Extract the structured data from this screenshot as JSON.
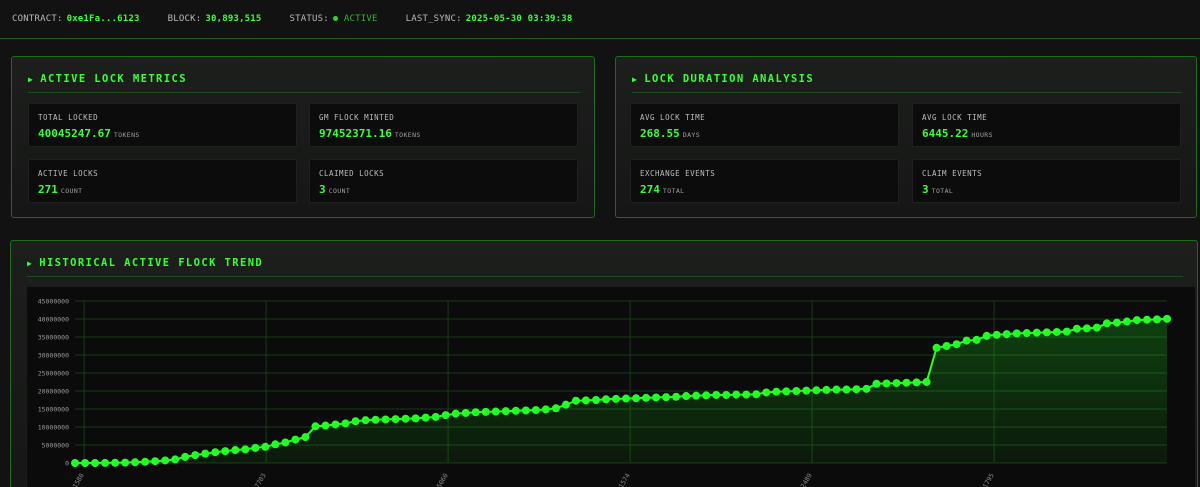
{
  "topbar": {
    "contract_label": "CONTRACT:",
    "contract_value": "0xe1Fa...6123",
    "block_label": "BLOCK:",
    "block_value": "30,893,515",
    "status_label": "STATUS:",
    "status_value": "ACTIVE",
    "sync_label": "LAST_SYNC:",
    "sync_value": "2025-05-30 03:39:38"
  },
  "lock_metrics": {
    "title": "ACTIVE LOCK METRICS",
    "cards": [
      {
        "label": "TOTAL LOCKED",
        "value": "40045247.67",
        "unit": "TOKENS"
      },
      {
        "label": "GM FLOCK MINTED",
        "value": "97452371.16",
        "unit": "TOKENS"
      },
      {
        "label": "ACTIVE LOCKS",
        "value": "271",
        "unit": "COUNT"
      },
      {
        "label": "CLAIMED LOCKS",
        "value": "3",
        "unit": "COUNT"
      }
    ]
  },
  "duration": {
    "title": "LOCK DURATION ANALYSIS",
    "cards": [
      {
        "label": "AVG LOCK TIME",
        "value": "268.55",
        "unit": "DAYS"
      },
      {
        "label": "AVG LOCK TIME",
        "value": "6445.22",
        "unit": "HOURS"
      },
      {
        "label": "EXCHANGE EVENTS",
        "value": "274",
        "unit": "TOTAL"
      },
      {
        "label": "CLAIM EVENTS",
        "value": "3",
        "unit": "TOTAL"
      }
    ]
  },
  "trend": {
    "title": "HISTORICAL ACTIVE FLOCK TREND"
  },
  "colors": {
    "accent": "#39ff39",
    "line": "#22ff22",
    "border": "#1e6b1e",
    "background": "#121212"
  },
  "chart_data": {
    "type": "line",
    "title": "HISTORICAL ACTIVE FLOCK TREND",
    "ylim": [
      0,
      45000000
    ],
    "y_ticks": [
      "0",
      "5000000",
      "10000000",
      "15000000",
      "20000000",
      "25000000",
      "30000000",
      "35000000",
      "40000000",
      "45000000"
    ],
    "x_ticks": [
      "1580",
      "7703",
      "5060",
      "1574",
      "2489",
      "1795"
    ],
    "grid": true,
    "series": [
      {
        "values": [
          0,
          0,
          0,
          30000,
          60000,
          100000,
          200000,
          350000,
          500000,
          700000,
          1000000,
          1700000,
          2200000,
          2600000,
          3000000,
          3300000,
          3600000,
          3800000,
          4200000,
          4500000,
          5200000,
          5700000,
          6500000,
          7200000,
          10200000,
          10400000,
          10700000,
          11000000,
          11600000,
          11900000,
          12000000,
          12100000,
          12200000,
          12300000,
          12400000,
          12600000,
          12800000,
          13300000,
          13700000,
          13900000,
          14100000,
          14200000,
          14300000,
          14400000,
          14500000,
          14600000,
          14700000,
          14900000,
          15200000,
          16200000,
          17300000,
          17400000,
          17500000,
          17700000,
          17800000,
          17900000,
          18000000,
          18100000,
          18200000,
          18300000,
          18400000,
          18600000,
          18700000,
          18800000,
          18900000,
          18900000,
          19000000,
          19000000,
          19100000,
          19600000,
          19800000,
          19900000,
          20000000,
          20100000,
          20200000,
          20300000,
          20400000,
          20400000,
          20500000,
          20600000,
          22000000,
          22100000,
          22200000,
          22300000,
          22400000,
          22500000,
          32000000,
          32500000,
          33000000,
          34000000,
          34200000,
          35300000,
          35600000,
          35800000,
          36000000,
          36100000,
          36200000,
          36300000,
          36400000,
          36500000,
          37300000,
          37400000,
          37600000,
          38800000,
          39000000,
          39300000,
          39700000,
          39800000,
          39900000,
          40045248
        ]
      }
    ]
  }
}
